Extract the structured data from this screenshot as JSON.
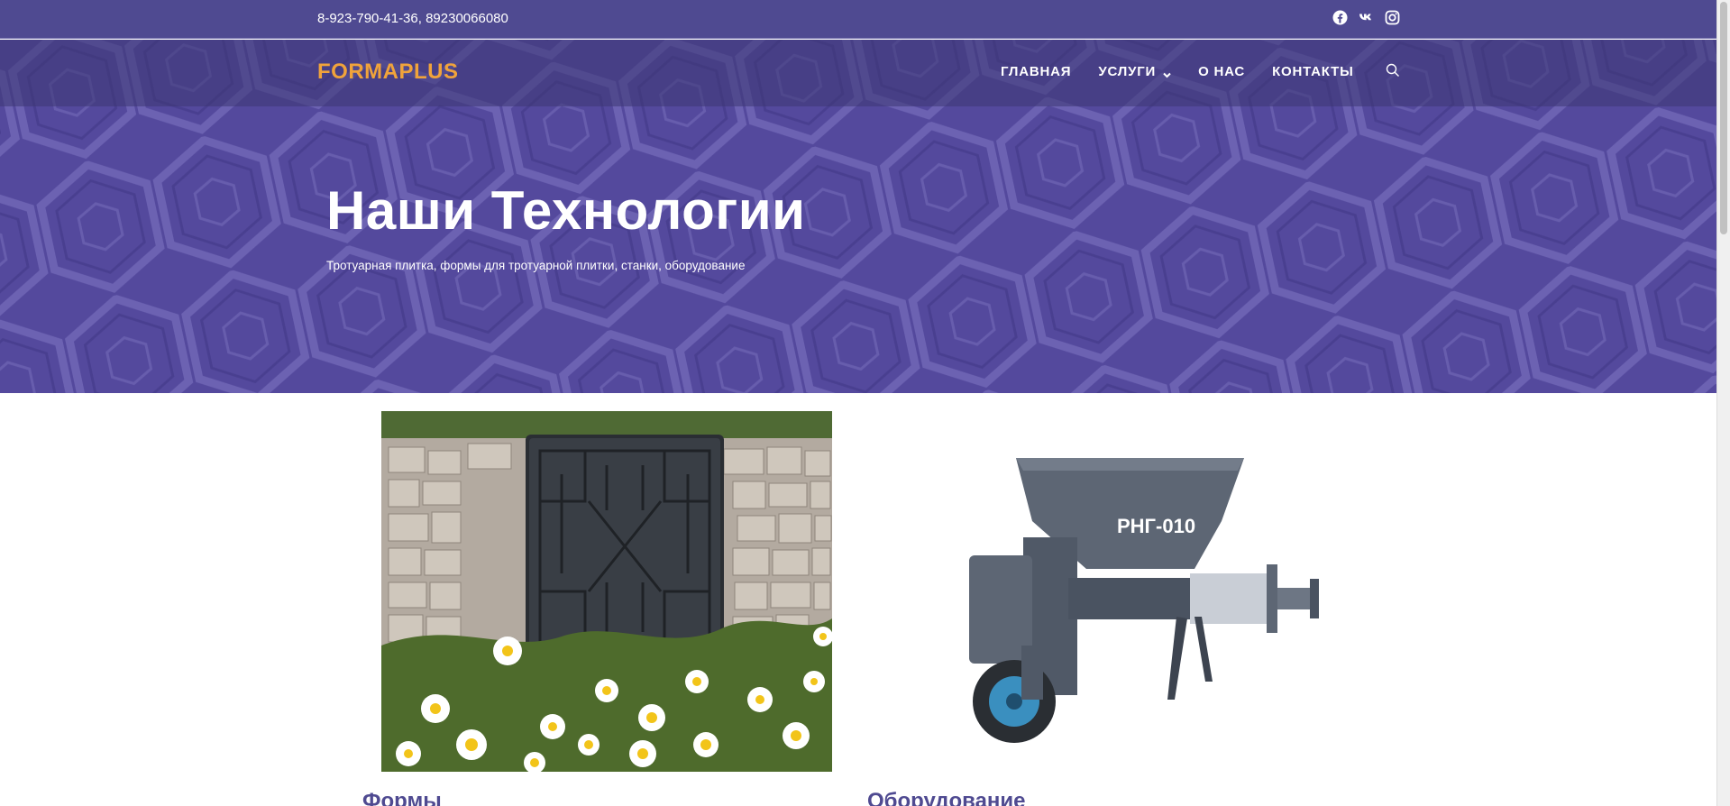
{
  "topbar": {
    "phone": "8-923-790-41-36, 89230066080",
    "socials": [
      "facebook-icon",
      "vk-icon",
      "instagram-icon"
    ]
  },
  "nav": {
    "logo": "FORMAPLUS",
    "items": [
      {
        "label": "ГЛАВНАЯ",
        "dropdown": false
      },
      {
        "label": "УСЛУГИ",
        "dropdown": true
      },
      {
        "label": "О НАС",
        "dropdown": false
      },
      {
        "label": "КОНТАКТЫ",
        "dropdown": false
      }
    ],
    "search_icon": "search-icon"
  },
  "hero": {
    "title": "Наши Технологии",
    "subtitle": "Тротуарная плитка, формы для тротуарной плитки, станки, оборудование"
  },
  "cards": [
    {
      "title": "Формы",
      "image": "mold-photo"
    },
    {
      "title": "Оборудование",
      "image": "machine-photo",
      "machine_label": "РНГ-010"
    }
  ],
  "colors": {
    "brand_purple": "#4f4a91",
    "logo_orange": "#f0a33b",
    "hero_bg": "#54499d"
  }
}
